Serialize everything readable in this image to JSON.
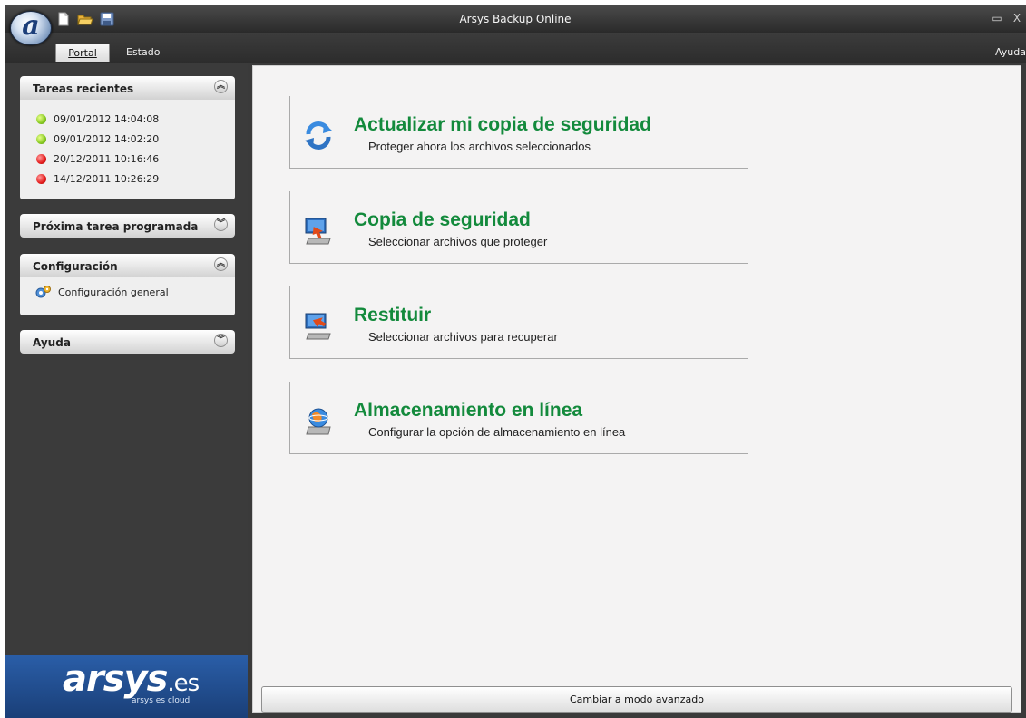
{
  "window": {
    "title": "Arsys Backup Online",
    "controls": {
      "minimize": "_",
      "maximize": "▭",
      "close": "X"
    },
    "logo_letter": "a"
  },
  "quick_tools": [
    {
      "icon": "new-document-icon"
    },
    {
      "icon": "open-folder-icon"
    },
    {
      "icon": "save-icon"
    }
  ],
  "menubar": {
    "tabs": [
      {
        "label": "Portal",
        "active": true
      },
      {
        "label": "Estado",
        "active": false
      }
    ],
    "help": "Ayuda"
  },
  "sidebar": {
    "recent_tasks": {
      "title": "Tareas recientes",
      "expanded": true,
      "items": [
        {
          "label": "09/01/2012 14:04:08",
          "status": "ok"
        },
        {
          "label": "09/01/2012 14:02:20",
          "status": "ok"
        },
        {
          "label": "20/12/2011 10:16:46",
          "status": "error"
        },
        {
          "label": "14/12/2011 10:26:29",
          "status": "error"
        }
      ]
    },
    "next_task": {
      "title": "Próxima tarea programada",
      "expanded": false
    },
    "configuration": {
      "title": "Configuración",
      "expanded": true,
      "items": [
        {
          "label": "Configuración general",
          "icon": "gears-icon"
        }
      ]
    },
    "help": {
      "title": "Ayuda",
      "expanded": false
    },
    "brand": {
      "name": "arsys",
      "suffix": ".es",
      "tagline": "arsys es cloud"
    }
  },
  "main": {
    "actions": [
      {
        "title": "Actualizar mi copia de seguridad",
        "description": "Proteger ahora los archivos seleccionados",
        "icon": "refresh-icon"
      },
      {
        "title": "Copia de seguridad",
        "description": "Seleccionar archivos que proteger",
        "icon": "backup-icon"
      },
      {
        "title": "Restituir",
        "description": "Seleccionar archivos para recuperar",
        "icon": "restore-icon"
      },
      {
        "title": "Almacenamiento en línea",
        "description": "Configurar la opción de almacenamiento en línea",
        "icon": "online-storage-icon"
      }
    ],
    "advanced_button": "Cambiar a modo avanzado"
  },
  "colors": {
    "accent_green": "#138a3c",
    "sidebar_bg": "#3b3b3b",
    "brand_blue": "#2a5ea8",
    "status_ok": "#86c820",
    "status_error": "#e41b1b"
  }
}
